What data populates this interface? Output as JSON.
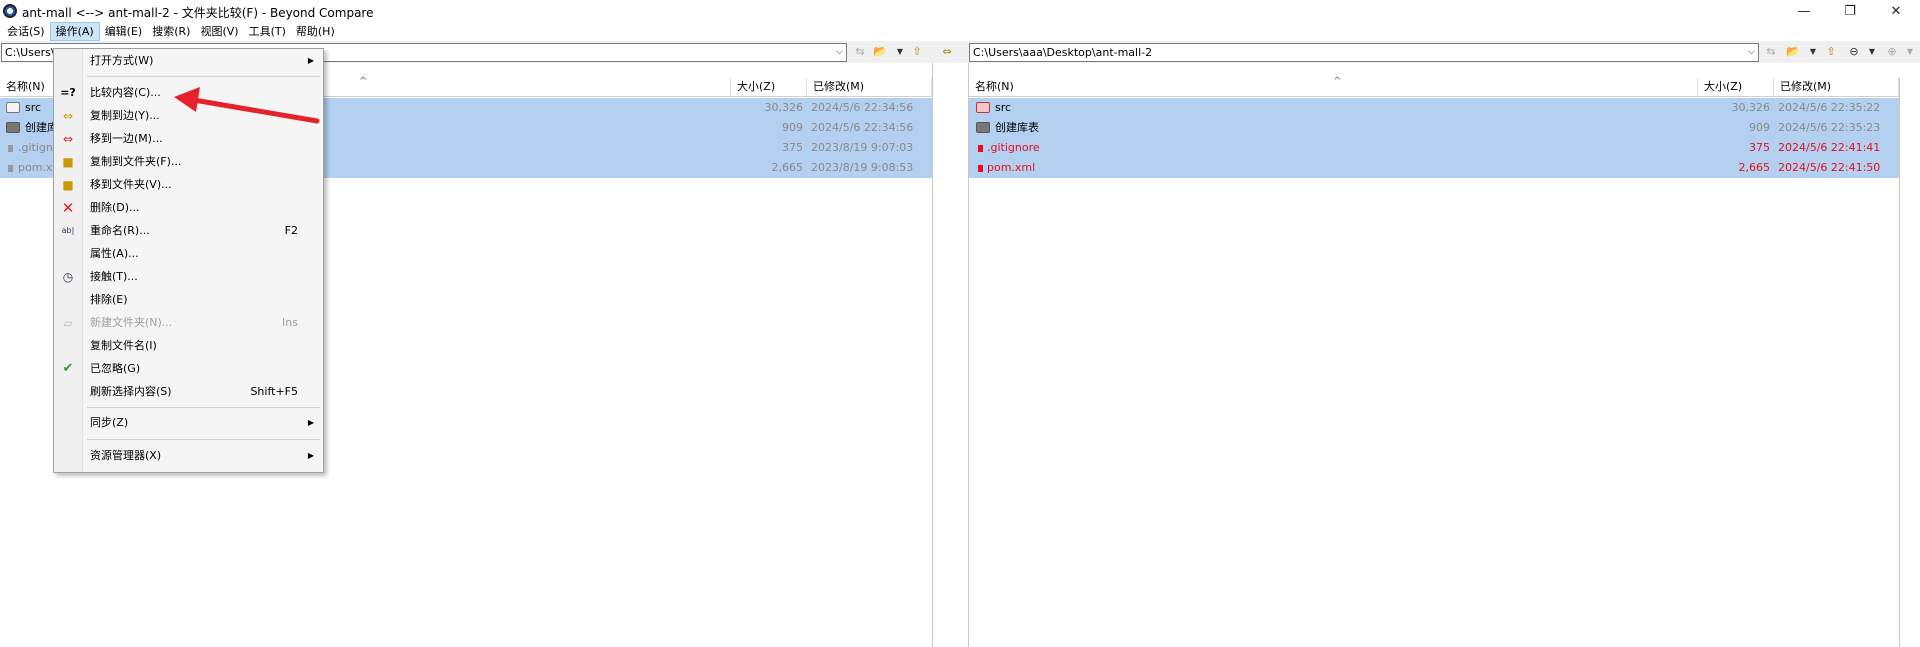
{
  "window": {
    "title": "ant-mall <--> ant-mall-2 - 文件夹比较(F) - Beyond Compare",
    "minimize": "—",
    "restore": "❐",
    "close": "✕"
  },
  "menubar": {
    "items": [
      "会话(S)",
      "操作(A)",
      "编辑(E)",
      "搜索(R)",
      "视图(V)",
      "工具(T)",
      "帮助(H)"
    ]
  },
  "left_pane": {
    "path": "C:\\Users\\",
    "columns": {
      "name": "名称(N)",
      "size": "大小(Z)",
      "modified": "已修改(M)"
    },
    "rows": [
      {
        "name": "src",
        "type": "folder",
        "size": "30,326",
        "modified": "2024/5/6 22:34:56",
        "color": "gray"
      },
      {
        "name": "创建库表",
        "type": "folder",
        "size": "909",
        "modified": "2024/5/6 22:34:56",
        "color": "gray"
      },
      {
        "name": ".gitignore",
        "type": "file",
        "size": "375",
        "modified": "2023/8/19 9:07:03",
        "color": "gray"
      },
      {
        "name": "pom.xml",
        "type": "file",
        "size": "2,665",
        "modified": "2023/8/19 9:08:53",
        "color": "gray"
      }
    ]
  },
  "right_pane": {
    "path": "C:\\Users\\aaa\\Desktop\\ant-mall-2",
    "columns": {
      "name": "名称(N)",
      "size": "大小(Z)",
      "modified": "已修改(M)"
    },
    "rows": [
      {
        "name": "src",
        "type": "folder",
        "size": "30,326",
        "modified": "2024/5/6 22:35:22",
        "color": "gray"
      },
      {
        "name": "创建库表",
        "type": "folder",
        "size": "909",
        "modified": "2024/5/6 22:35:23",
        "color": "gray"
      },
      {
        "name": ".gitignore",
        "type": "file",
        "size": "375",
        "modified": "2024/5/6 22:41:41",
        "color": "red"
      },
      {
        "name": "pom.xml",
        "type": "file",
        "size": "2,665",
        "modified": "2024/5/6 22:41:50",
        "color": "red"
      }
    ]
  },
  "context_menu": {
    "items": [
      {
        "label": "打开方式(W)",
        "shortcut": "",
        "submenu": true,
        "icon": "",
        "disabled": false
      },
      {
        "label": "比较内容(C)...",
        "shortcut": "",
        "submenu": false,
        "icon": "compare-icon",
        "disabled": false
      },
      {
        "label": "复制到边(Y)...",
        "shortcut": "",
        "submenu": false,
        "icon": "copy-to-side-icon",
        "disabled": false
      },
      {
        "label": "移到一边(M)...",
        "shortcut": "",
        "submenu": false,
        "icon": "move-to-side-icon",
        "disabled": false
      },
      {
        "label": "复制到文件夹(F)...",
        "shortcut": "",
        "submenu": false,
        "icon": "copy-to-folder-icon",
        "disabled": false
      },
      {
        "label": "移到文件夹(V)...",
        "shortcut": "",
        "submenu": false,
        "icon": "move-to-folder-icon",
        "disabled": false
      },
      {
        "label": "删除(D)...",
        "shortcut": "",
        "submenu": false,
        "icon": "delete-icon",
        "disabled": false
      },
      {
        "label": "重命名(R)...",
        "shortcut": "F2",
        "submenu": false,
        "icon": "rename-icon",
        "disabled": false
      },
      {
        "label": "属性(A)...",
        "shortcut": "",
        "submenu": false,
        "icon": "",
        "disabled": false
      },
      {
        "label": "接触(T)...",
        "shortcut": "",
        "submenu": false,
        "icon": "touch-icon",
        "disabled": false
      },
      {
        "label": "排除(E)",
        "shortcut": "",
        "submenu": false,
        "icon": "",
        "disabled": false
      },
      {
        "label": "新建文件夹(N)...",
        "shortcut": "Ins",
        "submenu": false,
        "icon": "new-folder-icon",
        "disabled": true
      },
      {
        "label": "复制文件名(I)",
        "shortcut": "",
        "submenu": false,
        "icon": "",
        "disabled": false
      },
      {
        "label": "已忽略(G)",
        "shortcut": "",
        "submenu": false,
        "icon": "check-icon",
        "disabled": false
      },
      {
        "label": "刷新选择内容(S)",
        "shortcut": "Shift+F5",
        "submenu": false,
        "icon": "",
        "disabled": false
      },
      {
        "label": "同步(Z)",
        "shortcut": "",
        "submenu": true,
        "icon": "",
        "disabled": false
      },
      {
        "label": "资源管理器(X)",
        "shortcut": "",
        "submenu": true,
        "icon": "",
        "disabled": false
      }
    ]
  },
  "colors": {
    "selection": "#b3d0f0",
    "diff_red": "#e8101e",
    "annotation_arrow": "#e5222b"
  }
}
